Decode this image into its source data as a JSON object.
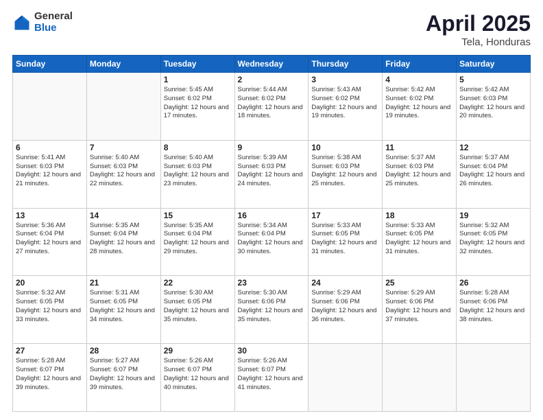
{
  "header": {
    "logo_general": "General",
    "logo_blue": "Blue",
    "title": "April 2025",
    "location": "Tela, Honduras"
  },
  "weekdays": [
    "Sunday",
    "Monday",
    "Tuesday",
    "Wednesday",
    "Thursday",
    "Friday",
    "Saturday"
  ],
  "weeks": [
    [
      {
        "day": "",
        "info": ""
      },
      {
        "day": "",
        "info": ""
      },
      {
        "day": "1",
        "info": "Sunrise: 5:45 AM\nSunset: 6:02 PM\nDaylight: 12 hours and 17 minutes."
      },
      {
        "day": "2",
        "info": "Sunrise: 5:44 AM\nSunset: 6:02 PM\nDaylight: 12 hours and 18 minutes."
      },
      {
        "day": "3",
        "info": "Sunrise: 5:43 AM\nSunset: 6:02 PM\nDaylight: 12 hours and 19 minutes."
      },
      {
        "day": "4",
        "info": "Sunrise: 5:42 AM\nSunset: 6:02 PM\nDaylight: 12 hours and 19 minutes."
      },
      {
        "day": "5",
        "info": "Sunrise: 5:42 AM\nSunset: 6:03 PM\nDaylight: 12 hours and 20 minutes."
      }
    ],
    [
      {
        "day": "6",
        "info": "Sunrise: 5:41 AM\nSunset: 6:03 PM\nDaylight: 12 hours and 21 minutes."
      },
      {
        "day": "7",
        "info": "Sunrise: 5:40 AM\nSunset: 6:03 PM\nDaylight: 12 hours and 22 minutes."
      },
      {
        "day": "8",
        "info": "Sunrise: 5:40 AM\nSunset: 6:03 PM\nDaylight: 12 hours and 23 minutes."
      },
      {
        "day": "9",
        "info": "Sunrise: 5:39 AM\nSunset: 6:03 PM\nDaylight: 12 hours and 24 minutes."
      },
      {
        "day": "10",
        "info": "Sunrise: 5:38 AM\nSunset: 6:03 PM\nDaylight: 12 hours and 25 minutes."
      },
      {
        "day": "11",
        "info": "Sunrise: 5:37 AM\nSunset: 6:03 PM\nDaylight: 12 hours and 25 minutes."
      },
      {
        "day": "12",
        "info": "Sunrise: 5:37 AM\nSunset: 6:04 PM\nDaylight: 12 hours and 26 minutes."
      }
    ],
    [
      {
        "day": "13",
        "info": "Sunrise: 5:36 AM\nSunset: 6:04 PM\nDaylight: 12 hours and 27 minutes."
      },
      {
        "day": "14",
        "info": "Sunrise: 5:35 AM\nSunset: 6:04 PM\nDaylight: 12 hours and 28 minutes."
      },
      {
        "day": "15",
        "info": "Sunrise: 5:35 AM\nSunset: 6:04 PM\nDaylight: 12 hours and 29 minutes."
      },
      {
        "day": "16",
        "info": "Sunrise: 5:34 AM\nSunset: 6:04 PM\nDaylight: 12 hours and 30 minutes."
      },
      {
        "day": "17",
        "info": "Sunrise: 5:33 AM\nSunset: 6:05 PM\nDaylight: 12 hours and 31 minutes."
      },
      {
        "day": "18",
        "info": "Sunrise: 5:33 AM\nSunset: 6:05 PM\nDaylight: 12 hours and 31 minutes."
      },
      {
        "day": "19",
        "info": "Sunrise: 5:32 AM\nSunset: 6:05 PM\nDaylight: 12 hours and 32 minutes."
      }
    ],
    [
      {
        "day": "20",
        "info": "Sunrise: 5:32 AM\nSunset: 6:05 PM\nDaylight: 12 hours and 33 minutes."
      },
      {
        "day": "21",
        "info": "Sunrise: 5:31 AM\nSunset: 6:05 PM\nDaylight: 12 hours and 34 minutes."
      },
      {
        "day": "22",
        "info": "Sunrise: 5:30 AM\nSunset: 6:05 PM\nDaylight: 12 hours and 35 minutes."
      },
      {
        "day": "23",
        "info": "Sunrise: 5:30 AM\nSunset: 6:06 PM\nDaylight: 12 hours and 35 minutes."
      },
      {
        "day": "24",
        "info": "Sunrise: 5:29 AM\nSunset: 6:06 PM\nDaylight: 12 hours and 36 minutes."
      },
      {
        "day": "25",
        "info": "Sunrise: 5:29 AM\nSunset: 6:06 PM\nDaylight: 12 hours and 37 minutes."
      },
      {
        "day": "26",
        "info": "Sunrise: 5:28 AM\nSunset: 6:06 PM\nDaylight: 12 hours and 38 minutes."
      }
    ],
    [
      {
        "day": "27",
        "info": "Sunrise: 5:28 AM\nSunset: 6:07 PM\nDaylight: 12 hours and 39 minutes."
      },
      {
        "day": "28",
        "info": "Sunrise: 5:27 AM\nSunset: 6:07 PM\nDaylight: 12 hours and 39 minutes."
      },
      {
        "day": "29",
        "info": "Sunrise: 5:26 AM\nSunset: 6:07 PM\nDaylight: 12 hours and 40 minutes."
      },
      {
        "day": "30",
        "info": "Sunrise: 5:26 AM\nSunset: 6:07 PM\nDaylight: 12 hours and 41 minutes."
      },
      {
        "day": "",
        "info": ""
      },
      {
        "day": "",
        "info": ""
      },
      {
        "day": "",
        "info": ""
      }
    ]
  ]
}
